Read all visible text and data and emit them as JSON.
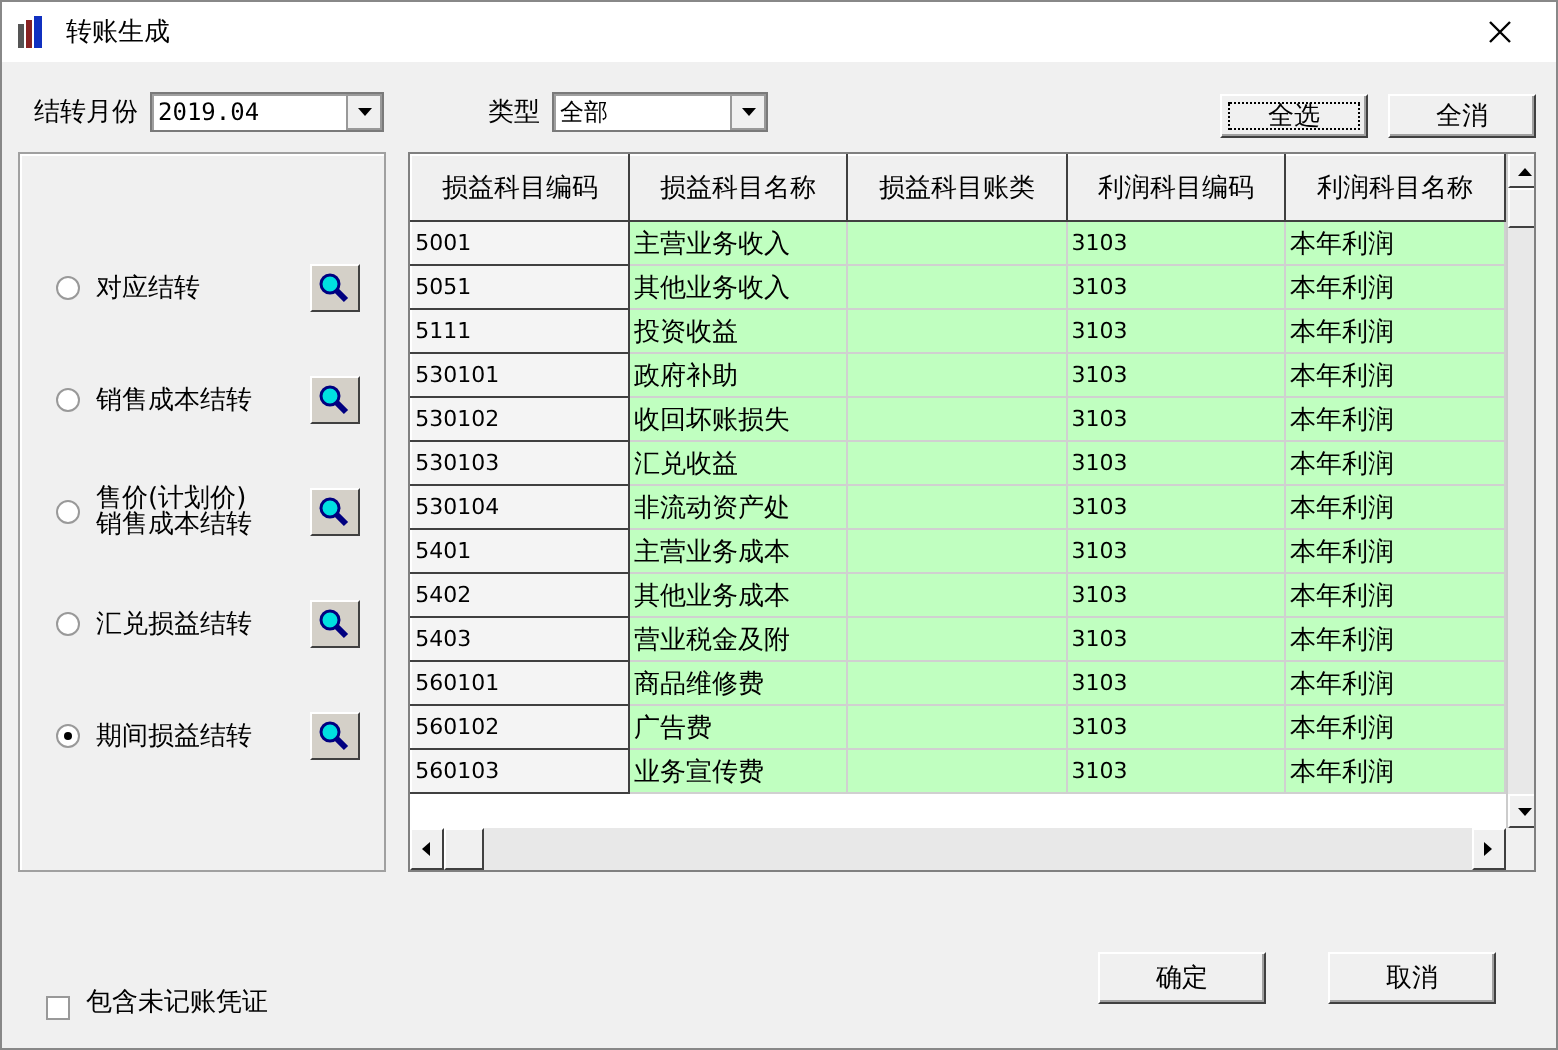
{
  "window": {
    "title": "转账生成"
  },
  "month": {
    "label": "结转月份",
    "value": "2019.04"
  },
  "type": {
    "label": "类型",
    "value": "全部"
  },
  "select_buttons": [
    {
      "label": "全选",
      "focused": true
    },
    {
      "label": "全消",
      "focused": false
    }
  ],
  "transfer_options": [
    {
      "label": "对应结转",
      "selected": false
    },
    {
      "label": "销售成本结转",
      "selected": false
    },
    {
      "label": "售价(计划价)\n销售成本结转",
      "selected": false
    },
    {
      "label": "汇兑损益结转",
      "selected": false
    },
    {
      "label": "期间损益结转",
      "selected": true
    }
  ],
  "table": {
    "columns": [
      "损益科目编码",
      "损益科目名称",
      "损益科目账类",
      "利润科目编码",
      "利润科目名称"
    ],
    "rows": [
      [
        "5001",
        "主营业务收入",
        "",
        "3103",
        "本年利润"
      ],
      [
        "5051",
        "其他业务收入",
        "",
        "3103",
        "本年利润"
      ],
      [
        "5111",
        "投资收益",
        "",
        "3103",
        "本年利润"
      ],
      [
        "530101",
        "政府补助",
        "",
        "3103",
        "本年利润"
      ],
      [
        "530102",
        "收回坏账损失",
        "",
        "3103",
        "本年利润"
      ],
      [
        "530103",
        "汇兑收益",
        "",
        "3103",
        "本年利润"
      ],
      [
        "530104",
        "非流动资产处",
        "",
        "3103",
        "本年利润"
      ],
      [
        "5401",
        "主营业务成本",
        "",
        "3103",
        "本年利润"
      ],
      [
        "5402",
        "其他业务成本",
        "",
        "3103",
        "本年利润"
      ],
      [
        "5403",
        "营业税金及附",
        "",
        "3103",
        "本年利润"
      ],
      [
        "560101",
        "商品维修费",
        "",
        "3103",
        "本年利润"
      ],
      [
        "560102",
        "广告费",
        "",
        "3103",
        "本年利润"
      ],
      [
        "560103",
        "业务宣传费",
        "",
        "3103",
        "本年利润"
      ]
    ]
  },
  "include_unposted": {
    "label": "包含未记账凭证",
    "checked": false
  },
  "buttons": [
    "确定",
    "取消"
  ]
}
